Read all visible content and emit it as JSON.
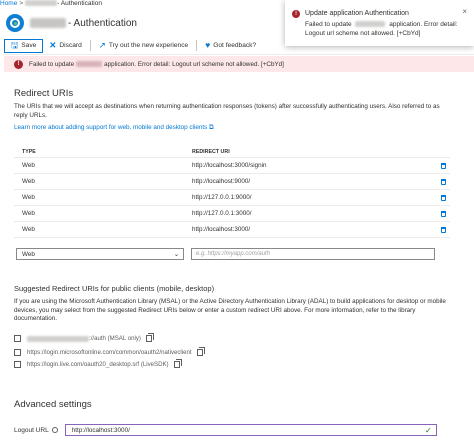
{
  "breadcrumb": {
    "home": "Home",
    "separator": ">",
    "current": "- Authentication"
  },
  "header": {
    "title": "- Authentication"
  },
  "toolbar": {
    "save_label": "Save",
    "discard_label": "Discard",
    "try_label": "Try out the new experience",
    "feedback_label": "Got feedback?"
  },
  "error_banner": {
    "prefix": "Failed to update",
    "suffix": "application. Error detail: Logout url scheme not allowed. [+CbYd]"
  },
  "toast": {
    "title": "Update application Authentication",
    "body_prefix": "Failed to update",
    "body_suffix": "application. Error detail: Logout url scheme not allowed. [+CbYd]",
    "close": "×"
  },
  "redirect": {
    "heading": "Redirect URIs",
    "description": "The URIs that we will accept as destinations when returning authentication responses (tokens) after successfully authenticating users. Also referred to as reply URLs.",
    "learn_more": "Learn more about adding support for web, mobile and desktop clients",
    "col_type": "TYPE",
    "col_uri": "REDIRECT URI",
    "rows": [
      {
        "type": "Web",
        "uri": "http://localhost:3000/signin"
      },
      {
        "type": "Web",
        "uri": "http://localhost:9000/"
      },
      {
        "type": "Web",
        "uri": "http://127.0.0.1:9000/"
      },
      {
        "type": "Web",
        "uri": "http://127.0.0.1:3000/"
      },
      {
        "type": "Web",
        "uri": "http://localhost:3000/"
      }
    ],
    "new_type": "Web",
    "new_uri_placeholder": "e.g. https://myapp.com/auth"
  },
  "suggested": {
    "heading": "Suggested Redirect URIs for public clients (mobile, desktop)",
    "description": "If you are using the Microsoft Authentication Library (MSAL) or the Active Directory Authentication Library (ADAL) to build applications for desktop or mobile devices, you may select from the suggested Redirect URIs below or enter a custom redirect URI above. For more information, refer to the library documentation.",
    "items": [
      {
        "uri_suffix": "://auth (MSAL only)"
      },
      {
        "uri": "https://login.microsoftonline.com/common/oauth2/nativeclient"
      },
      {
        "uri": "https://login.live.com/oauth20_desktop.srf (LiveSDK)"
      }
    ]
  },
  "advanced": {
    "heading": "Advanced settings",
    "logout_label": "Logout URL",
    "logout_value": "http://localhost:3000/"
  },
  "colors": {
    "accent": "#0078d4",
    "error": "#a4262c",
    "error_bg": "#fde7e9",
    "success": "#107c10"
  }
}
